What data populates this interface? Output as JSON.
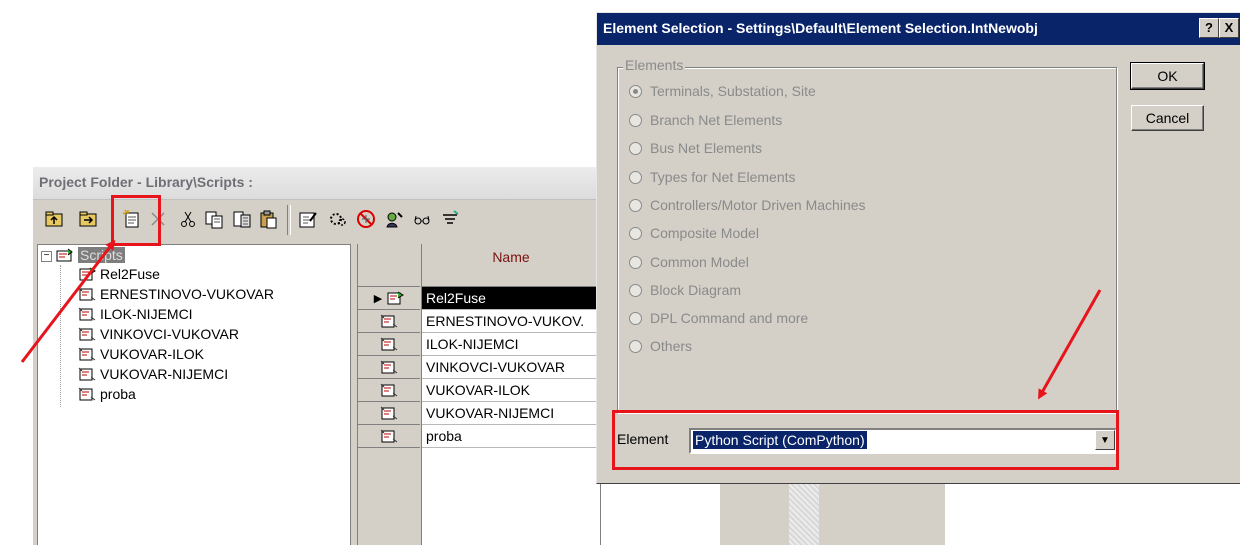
{
  "project_folder": {
    "title": "Project Folder - Library\\Scripts :",
    "toolbar_icons": [
      "folder-up-icon",
      "folder-open-icon",
      "new-object-icon",
      "delete-icon",
      "cut-icon",
      "copy-icon",
      "paste-special-icon",
      "paste-icon",
      "edit-icon",
      "execute-icon",
      "block-icon",
      "find-icon",
      "glasses-icon",
      "filter-icon"
    ],
    "tree": {
      "root": "Scripts",
      "items": [
        "Rel2Fuse",
        "ERNESTINOVO-VUKOVAR",
        "ILOK-NIJEMCI",
        "VINKOVCI-VUKOVAR",
        "VUKOVAR-ILOK",
        "VUKOVAR-NIJEMCI",
        "proba"
      ]
    },
    "table": {
      "column_name": "Name",
      "rows": [
        "Rel2Fuse",
        "ERNESTINOVO-VUKOV.",
        "ILOK-NIJEMCI",
        "VINKOVCI-VUKOVAR",
        "VUKOVAR-ILOK",
        "VUKOVAR-NIJEMCI",
        "proba"
      ],
      "selected_index": 0
    }
  },
  "element_selection": {
    "title": "Element Selection - Settings\\Default\\Element Selection.IntNewobj",
    "help_button": "?",
    "close_button": "X",
    "group_label": "Elements",
    "options": [
      "Terminals, Substation, Site",
      "Branch Net Elements",
      "Bus Net Elements",
      "Types for Net Elements",
      "Controllers/Motor Driven Machines",
      "Composite Model",
      "Common Model",
      "Block Diagram",
      "DPL Command and more",
      "Others"
    ],
    "selected_option": 0,
    "ok_label": "OK",
    "cancel_label": "Cancel",
    "element_label": "Element",
    "element_value": "Python Script (ComPython)"
  },
  "annotation_color": "#e8141c"
}
